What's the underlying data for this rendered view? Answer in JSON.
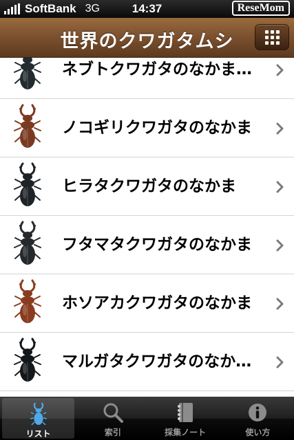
{
  "status_bar": {
    "carrier": "SoftBank",
    "network": "3G",
    "time": "14:37",
    "watermark": "ReseMom"
  },
  "nav": {
    "title": "世界のクワガタムシ",
    "menu_icon": "grid-menu-icon"
  },
  "list": {
    "items": [
      {
        "label": "ネブトクワガタのなかま…",
        "icon": "stag-beetle-icon",
        "color": "#222c30"
      },
      {
        "label": "ノコギリクワガタのなかま",
        "icon": "stag-beetle-icon",
        "color": "#7a3a22"
      },
      {
        "label": "ヒラタクワガタのなかま",
        "icon": "stag-beetle-icon",
        "color": "#1e2328"
      },
      {
        "label": "フタマタクワガタのなかま",
        "icon": "stag-beetle-icon",
        "color": "#25292c"
      },
      {
        "label": "ホソアカクワガタのなかま",
        "icon": "stag-beetle-icon",
        "color": "#8a3c20"
      },
      {
        "label": "マルガタクワガタのなか…",
        "icon": "stag-beetle-icon",
        "color": "#15181b"
      }
    ]
  },
  "tab_bar": {
    "tabs": [
      {
        "label": "リスト",
        "icon": "beetle-icon",
        "selected": true
      },
      {
        "label": "索引",
        "icon": "search-icon",
        "selected": false
      },
      {
        "label": "採集ノート",
        "icon": "notebook-icon",
        "selected": false
      },
      {
        "label": "使い方",
        "icon": "info-icon",
        "selected": false
      }
    ]
  }
}
